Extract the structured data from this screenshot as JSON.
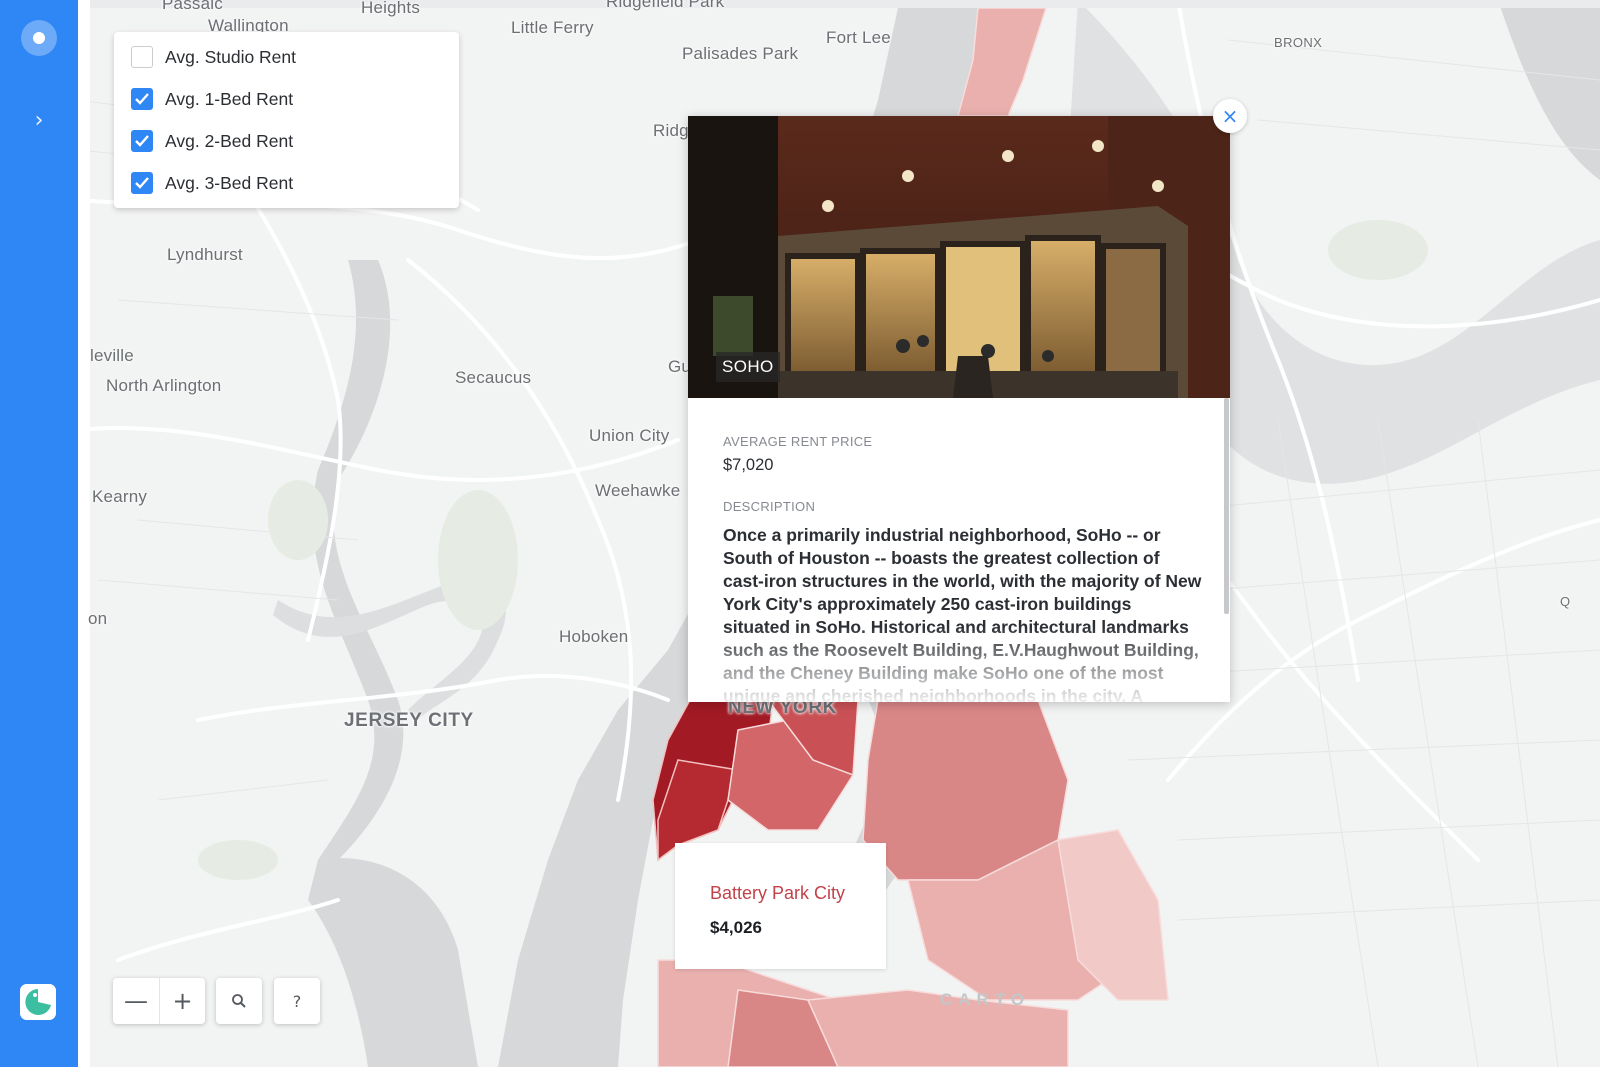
{
  "rail": {
    "logo_icon": "carto-dot-icon",
    "expand_icon": "chevron-right-icon",
    "app_icon": "pac-logo-icon"
  },
  "layers": {
    "items": [
      {
        "label": "Avg. Studio Rent",
        "checked": false
      },
      {
        "label": "Avg. 1-Bed Rent",
        "checked": true
      },
      {
        "label": "Avg. 2-Bed Rent",
        "checked": true
      },
      {
        "label": "Avg. 3-Bed Rent",
        "checked": true
      }
    ]
  },
  "map": {
    "places": {
      "passaic": "Passaic",
      "wallington": "Wallington",
      "heights": "Heights",
      "little_ferry": "Little Ferry",
      "ridgefield_park": "Ridgefield Park",
      "fort_lee": "Fort Lee",
      "palisades_park": "Palisades Park",
      "bronx": "BRONX",
      "ridgefield": "Ridg",
      "lyndhurst": "Lyndhurst",
      "belleville": "leville",
      "north_arlington": "North Arlington",
      "secaucus": "Secaucus",
      "guttenberg": "Gu",
      "union_city": "Union City",
      "weehawken": "Weehawke",
      "kearny": "Kearny",
      "harrison": "on",
      "hoboken": "Hoboken",
      "jersey_city": "JERSEY CITY",
      "new_york": "NEW YORK",
      "queens_edge": "Q"
    },
    "attribution": "CARTO",
    "choropleth_colors": {
      "darkest": "#a11a24",
      "dark": "#c8393f",
      "mid": "#d98786",
      "light": "#e9b0ae",
      "lightest": "#f1c9c6"
    }
  },
  "popup": {
    "neighborhood": "SOHO",
    "price_label": "AVERAGE RENT PRICE",
    "price_value": "$7,020",
    "desc_label": "DESCRIPTION",
    "description": "Once a primarily industrial neighborhood, SoHo -- or South of Houston -- boasts the greatest collection of cast-iron structures in the world, with the majority of New York City's approximately 250 cast-iron buildings situated in SoHo. Historical and architectural landmarks such as the Roosevelt Building, E.V.Haughwout Building, and the Cheney Building make SoHo one of the most unique and cherished neighborhoods in the city. A onetime haven",
    "close_symbol": "×"
  },
  "tooltip": {
    "name": "Battery Park City",
    "value": "$4,026"
  },
  "controls": {
    "zoom_out": "—",
    "zoom_in": "+",
    "search_icon": "search-icon",
    "help": "?"
  }
}
